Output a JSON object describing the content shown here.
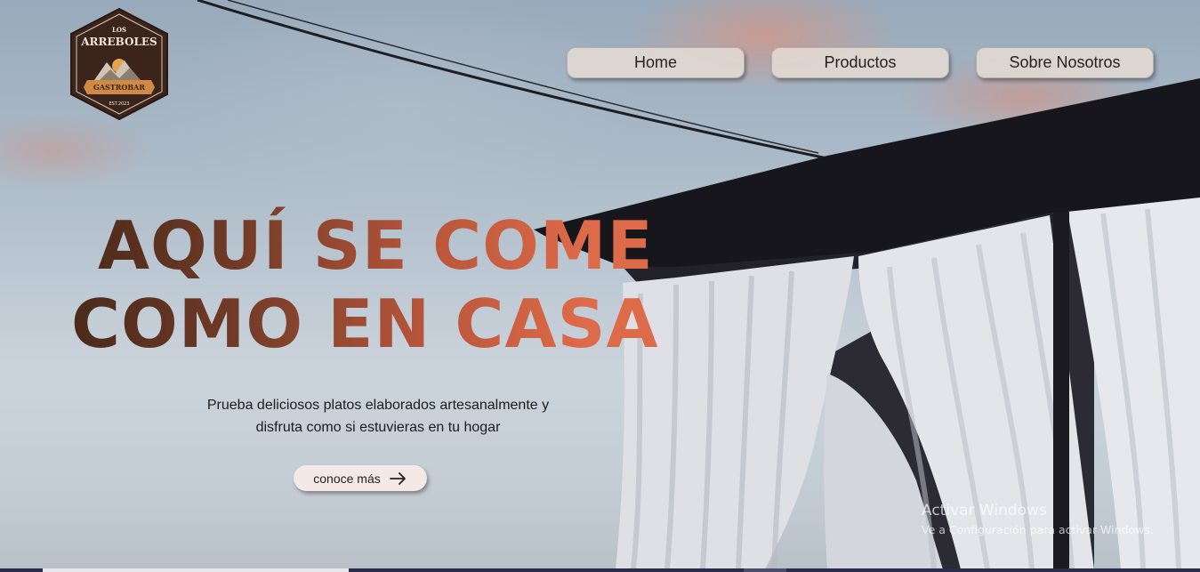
{
  "brand": {
    "top": "LOS",
    "name": "ARREBOLES",
    "ribbon": "GASTROBAR",
    "est": "EST.2023"
  },
  "nav": {
    "items": [
      {
        "label": "Home"
      },
      {
        "label": "Productos"
      },
      {
        "label": "Sobre Nosotros"
      }
    ]
  },
  "hero": {
    "headline_line1": "AQUÍ SE COME",
    "headline_line2": "COMO EN CASA",
    "subtitle_line1": "Prueba deliciosos platos elaborados artesanalmente y",
    "subtitle_line2": "disfruta como si estuvieras en tu hogar",
    "cta_label": "conoce más"
  },
  "system": {
    "watermark_title": "Activar Windows",
    "watermark_text": "Ve a Configuración para activar Windows."
  },
  "colors": {
    "headline_dark": "#4a2a1a",
    "headline_light": "#dd6a48",
    "nav_bg": "#e8ded6",
    "logo_bg": "#3b241b"
  },
  "icons": {
    "cta": "arrow-right-icon"
  }
}
